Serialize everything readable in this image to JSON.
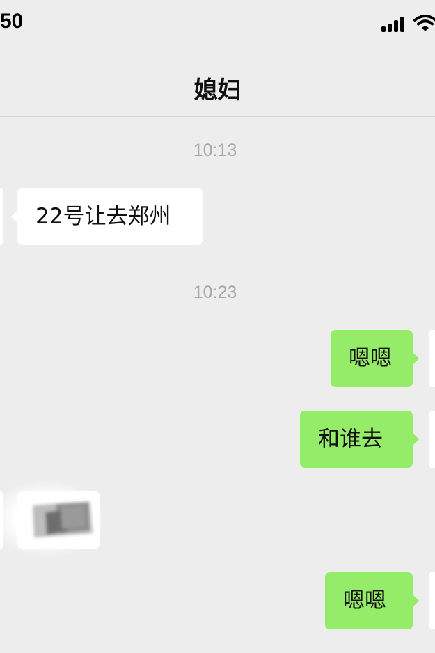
{
  "status_bar": {
    "time": "50",
    "icons": [
      "cellular-signal-icon",
      "wifi-icon"
    ]
  },
  "chat": {
    "contact_name": "媳妇",
    "messages": [
      {
        "type": "timestamp",
        "text": "10:13"
      },
      {
        "type": "text",
        "direction": "incoming",
        "text": "22号让去郑州"
      },
      {
        "type": "timestamp",
        "text": "10:23"
      },
      {
        "type": "text",
        "direction": "outgoing",
        "text": "嗯嗯"
      },
      {
        "type": "text",
        "direction": "outgoing",
        "text": "和谁去"
      },
      {
        "type": "image",
        "direction": "incoming"
      },
      {
        "type": "text",
        "direction": "outgoing",
        "text": "嗯嗯"
      }
    ]
  },
  "colors": {
    "background": "#ededed",
    "outgoing_bubble": "#95ec69",
    "incoming_bubble": "#ffffff",
    "timestamp_text": "#a8a8a8"
  }
}
